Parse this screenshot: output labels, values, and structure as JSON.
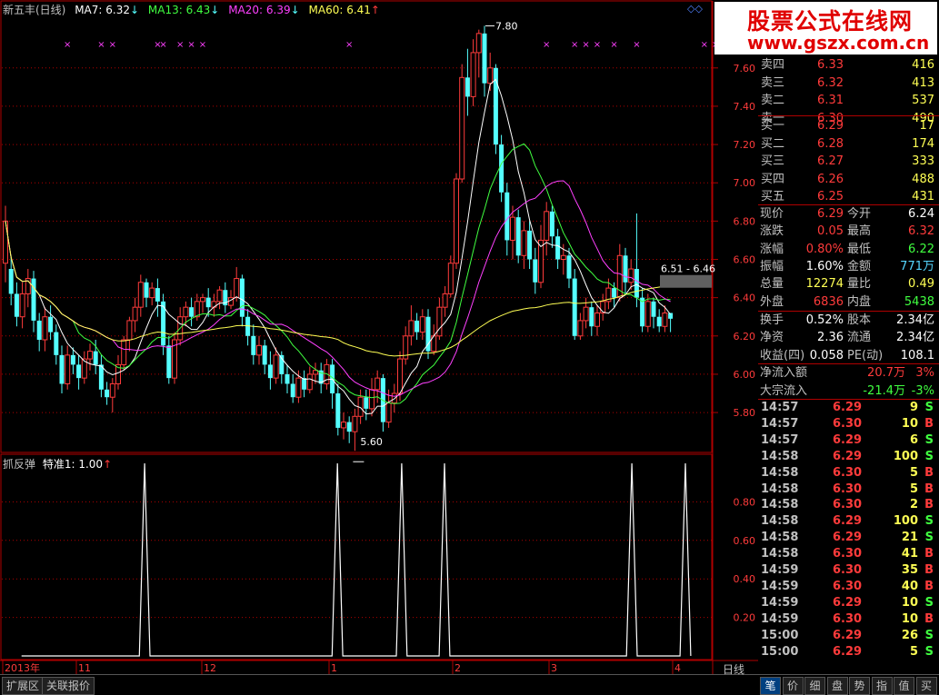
{
  "header": {
    "stock": "新五丰(日线)",
    "ma7": "MA7: 6.32",
    "ma13": "MA13: 6.43",
    "ma20": "MA20: 6.39",
    "ma60": "MA60: 6.41",
    "arrow_down": "↓",
    "arrow_up": "↑",
    "corner_icons": "◇◇"
  },
  "indicator": {
    "title": "抓反弹",
    "value": "特准1: 1.00",
    "arrow": "↑"
  },
  "chart_data": {
    "type": "candlestick",
    "title": "新五丰(日线)",
    "price_ticks": [
      "7.60",
      "7.40",
      "7.20",
      "7.00",
      "6.80",
      "6.60",
      "6.40",
      "6.20",
      "6.00",
      "5.80"
    ],
    "price_range": [
      5.62,
      7.86
    ],
    "indicator_ticks": [
      "0.80",
      "0.60",
      "0.40",
      "0.20"
    ],
    "indicator_range": [
      0,
      1
    ],
    "x_labels": [
      "2013年",
      "11",
      "12",
      "1",
      "2",
      "3",
      "4"
    ],
    "annotations": {
      "high": "7.80",
      "low": "5.60",
      "range": "6.51 - 6.46"
    },
    "candles": [
      [
        6.58,
        6.8,
        6.48,
        6.88
      ],
      [
        6.55,
        6.42,
        6.36,
        6.62
      ],
      [
        6.42,
        6.3,
        6.25,
        6.48
      ],
      [
        6.3,
        6.42,
        6.24,
        6.48
      ],
      [
        6.42,
        6.5,
        6.35,
        6.55
      ],
      [
        6.5,
        6.28,
        6.22,
        6.54
      ],
      [
        6.28,
        6.18,
        6.12,
        6.32
      ],
      [
        6.18,
        6.3,
        6.12,
        6.35
      ],
      [
        6.3,
        6.22,
        6.18,
        6.36
      ],
      [
        6.22,
        6.1,
        6.05,
        6.26
      ],
      [
        6.1,
        5.95,
        5.9,
        6.15
      ],
      [
        5.95,
        6.1,
        5.92,
        6.15
      ],
      [
        6.1,
        6.05,
        6.0,
        6.14
      ],
      [
        6.05,
        5.98,
        5.92,
        6.1
      ],
      [
        5.98,
        6.08,
        5.95,
        6.12
      ],
      [
        6.08,
        6.12,
        6.02,
        6.16
      ],
      [
        6.12,
        6.05,
        6.0,
        6.18
      ],
      [
        6.05,
        5.92,
        5.88,
        6.1
      ],
      [
        5.92,
        5.88,
        5.84,
        5.96
      ],
      [
        5.88,
        5.95,
        5.8,
        5.98
      ],
      [
        5.95,
        6.05,
        5.92,
        6.1
      ],
      [
        6.05,
        6.18,
        6.02,
        6.2
      ],
      [
        6.18,
        6.28,
        6.12,
        6.3
      ],
      [
        6.28,
        6.35,
        6.22,
        6.4
      ],
      [
        6.35,
        6.48,
        6.3,
        6.52
      ],
      [
        6.48,
        6.4,
        6.35,
        6.5
      ],
      [
        6.4,
        6.45,
        6.36,
        6.48
      ],
      [
        6.45,
        6.38,
        6.3,
        6.5
      ],
      [
        6.38,
        6.15,
        6.1,
        6.42
      ],
      [
        6.15,
        5.98,
        5.95,
        6.2
      ],
      [
        5.98,
        6.18,
        5.95,
        6.22
      ],
      [
        6.18,
        6.3,
        6.15,
        6.35
      ],
      [
        6.3,
        6.35,
        6.25,
        6.38
      ],
      [
        6.35,
        6.3,
        6.25,
        6.4
      ],
      [
        6.3,
        6.38,
        6.28,
        6.42
      ],
      [
        6.38,
        6.4,
        6.32,
        6.42
      ],
      [
        6.4,
        6.35,
        6.3,
        6.45
      ],
      [
        6.35,
        6.38,
        6.3,
        6.42
      ],
      [
        6.38,
        6.44,
        6.34,
        6.46
      ],
      [
        6.44,
        6.36,
        6.32,
        6.48
      ],
      [
        6.36,
        6.4,
        6.34,
        6.44
      ],
      [
        6.4,
        6.5,
        6.38,
        6.56
      ],
      [
        6.5,
        6.3,
        6.25,
        6.52
      ],
      [
        6.3,
        6.2,
        6.15,
        6.34
      ],
      [
        6.2,
        6.1,
        6.05,
        6.26
      ],
      [
        6.1,
        6.15,
        6.05,
        6.2
      ],
      [
        6.15,
        6.05,
        6.0,
        6.18
      ],
      [
        6.05,
        5.98,
        5.92,
        6.12
      ],
      [
        5.98,
        6.1,
        5.95,
        6.14
      ],
      [
        6.1,
        6.0,
        5.95,
        6.12
      ],
      [
        6.0,
        5.95,
        5.9,
        6.05
      ],
      [
        5.95,
        5.88,
        5.85,
        6.0
      ],
      [
        5.88,
        5.98,
        5.85,
        6.02
      ],
      [
        5.98,
        5.92,
        5.88,
        6.02
      ],
      [
        5.92,
        6.0,
        5.9,
        6.04
      ],
      [
        6.0,
        6.02,
        5.95,
        6.06
      ],
      [
        6.02,
        5.95,
        5.9,
        6.06
      ],
      [
        5.95,
        6.05,
        5.92,
        6.08
      ],
      [
        6.05,
        5.9,
        5.82,
        6.08
      ],
      [
        5.9,
        5.72,
        5.68,
        5.95
      ],
      [
        5.72,
        5.75,
        5.66,
        5.8
      ],
      [
        5.75,
        5.7,
        5.64,
        5.78
      ],
      [
        5.7,
        5.78,
        5.6,
        5.82
      ],
      [
        5.78,
        5.88,
        5.74,
        5.92
      ],
      [
        5.88,
        5.82,
        5.76,
        5.92
      ],
      [
        5.82,
        5.92,
        5.78,
        5.98
      ],
      [
        5.92,
        5.98,
        5.85,
        6.02
      ],
      [
        5.98,
        5.75,
        5.7,
        6.0
      ],
      [
        5.75,
        5.85,
        5.72,
        5.92
      ],
      [
        5.85,
        5.9,
        5.8,
        5.95
      ],
      [
        5.9,
        6.08,
        5.86,
        6.12
      ],
      [
        6.08,
        6.2,
        6.05,
        6.25
      ],
      [
        6.2,
        6.28,
        6.15,
        6.36
      ],
      [
        6.28,
        6.22,
        6.18,
        6.32
      ],
      [
        6.22,
        6.3,
        6.18,
        6.34
      ],
      [
        6.3,
        6.12,
        6.08,
        6.34
      ],
      [
        6.12,
        6.2,
        6.1,
        6.26
      ],
      [
        6.2,
        6.35,
        6.18,
        6.4
      ],
      [
        6.35,
        6.42,
        6.3,
        6.46
      ],
      [
        6.42,
        6.58,
        6.4,
        6.62
      ],
      [
        6.58,
        7.02,
        6.55,
        7.05
      ],
      [
        7.02,
        7.55,
        7.0,
        7.62
      ],
      [
        7.55,
        7.45,
        7.35,
        7.7
      ],
      [
        7.45,
        7.68,
        7.4,
        7.75
      ],
      [
        7.68,
        7.78,
        7.55,
        7.8
      ],
      [
        7.78,
        7.52,
        7.45,
        7.82
      ],
      [
        7.52,
        7.6,
        7.48,
        7.68
      ],
      [
        7.6,
        7.2,
        7.15,
        7.62
      ],
      [
        7.2,
        6.95,
        6.9,
        7.25
      ],
      [
        6.95,
        6.7,
        6.62,
        7.0
      ],
      [
        6.7,
        6.82,
        6.6,
        6.88
      ],
      [
        6.82,
        6.62,
        6.58,
        6.86
      ],
      [
        6.62,
        6.75,
        6.55,
        6.8
      ],
      [
        6.75,
        6.6,
        6.55,
        6.8
      ],
      [
        6.6,
        6.48,
        6.42,
        6.66
      ],
      [
        6.48,
        6.7,
        6.45,
        6.78
      ],
      [
        6.7,
        6.85,
        6.62,
        6.9
      ],
      [
        6.85,
        6.72,
        6.66,
        6.88
      ],
      [
        6.72,
        6.6,
        6.55,
        6.76
      ],
      [
        6.6,
        6.62,
        6.52,
        6.68
      ],
      [
        6.62,
        6.5,
        6.45,
        6.66
      ],
      [
        6.5,
        6.2,
        6.18,
        6.55
      ],
      [
        6.2,
        6.28,
        6.18,
        6.32
      ],
      [
        6.28,
        6.35,
        6.24,
        6.4
      ],
      [
        6.35,
        6.25,
        6.2,
        6.38
      ],
      [
        6.25,
        6.32,
        6.2,
        6.36
      ],
      [
        6.32,
        6.38,
        6.28,
        6.42
      ],
      [
        6.38,
        6.45,
        6.34,
        6.5
      ],
      [
        6.45,
        6.4,
        6.35,
        6.48
      ],
      [
        6.4,
        6.62,
        6.38,
        6.68
      ],
      [
        6.62,
        6.48,
        6.42,
        6.66
      ],
      [
        6.48,
        6.55,
        6.44,
        6.6
      ],
      [
        6.55,
        6.4,
        6.35,
        6.84
      ],
      [
        6.4,
        6.25,
        6.22,
        6.45
      ],
      [
        6.25,
        6.38,
        6.22,
        6.42
      ],
      [
        6.38,
        6.3,
        6.24,
        6.4
      ],
      [
        6.3,
        6.25,
        6.22,
        6.34
      ],
      [
        6.25,
        6.32,
        6.22,
        6.36
      ],
      [
        6.32,
        6.29,
        6.22,
        6.32
      ]
    ],
    "signals": [
      26,
      62,
      74,
      82,
      117,
      127,
      132
    ],
    "mark_columns": [
      11,
      17,
      19,
      27,
      28,
      31,
      33,
      35,
      61,
      96,
      101,
      103,
      105,
      108,
      112,
      124,
      126,
      128
    ]
  },
  "quotes": {
    "ask": [
      {
        "label": "卖四",
        "price": "6.33",
        "vol": "416"
      },
      {
        "label": "卖三",
        "price": "6.32",
        "vol": "413"
      },
      {
        "label": "卖二",
        "price": "6.31",
        "vol": "537"
      },
      {
        "label": "卖一",
        "price": "6.30",
        "vol": "490"
      }
    ],
    "bid": [
      {
        "label": "买一",
        "price": "6.29",
        "vol": "17"
      },
      {
        "label": "买二",
        "price": "6.28",
        "vol": "174"
      },
      {
        "label": "买三",
        "price": "6.27",
        "vol": "333"
      },
      {
        "label": "买四",
        "price": "6.26",
        "vol": "488"
      },
      {
        "label": "买五",
        "price": "6.25",
        "vol": "431"
      }
    ],
    "stats": [
      {
        "l1": "现价",
        "v1": "6.29",
        "c1": "#ff3b3b",
        "l2": "今开",
        "v2": "6.24",
        "c2": "#ffffff"
      },
      {
        "l1": "涨跌",
        "v1": "0.05",
        "c1": "#ff3b3b",
        "l2": "最高",
        "v2": "6.32",
        "c2": "#ff3b3b"
      },
      {
        "l1": "涨幅",
        "v1": "0.80%",
        "c1": "#ff3b3b",
        "l2": "最低",
        "v2": "6.22",
        "c2": "#40ff40"
      },
      {
        "l1": "振幅",
        "v1": "1.60%",
        "c1": "#ffffff",
        "l2": "金额",
        "v2": "771万",
        "c2": "#56d6ff"
      },
      {
        "l1": "总量",
        "v1": "12274",
        "c1": "#ffff54",
        "l2": "量比",
        "v2": "0.49",
        "c2": "#ffff54"
      },
      {
        "l1": "外盘",
        "v1": "6836",
        "c1": "#ff3b3b",
        "l2": "内盘",
        "v2": "5438",
        "c2": "#40ff40"
      }
    ],
    "stats2": [
      {
        "l1": "换手",
        "v1": "0.52%",
        "l2": "股本",
        "v2": "2.34亿"
      },
      {
        "l1": "净资",
        "v1": "2.36",
        "l2": "流通",
        "v2": "2.34亿"
      },
      {
        "l1": "收益(四)",
        "v1": "0.058",
        "l2": "PE(动)",
        "v2": "108.1"
      }
    ],
    "flow": [
      {
        "label": "净流入额",
        "value": "20.7万",
        "pct": "3%",
        "color": "#ff3b3b"
      },
      {
        "label": "大宗流入",
        "value": "-21.4万",
        "pct": "-3%",
        "color": "#40ff40"
      }
    ]
  },
  "ticks": [
    {
      "t": "14:57",
      "p": "6.29",
      "v": "9",
      "bs": "S"
    },
    {
      "t": "14:57",
      "p": "6.30",
      "v": "10",
      "bs": "B"
    },
    {
      "t": "14:57",
      "p": "6.29",
      "v": "6",
      "bs": "S"
    },
    {
      "t": "14:58",
      "p": "6.29",
      "v": "100",
      "bs": "S"
    },
    {
      "t": "14:58",
      "p": "6.30",
      "v": "5",
      "bs": "B"
    },
    {
      "t": "14:58",
      "p": "6.30",
      "v": "5",
      "bs": "B"
    },
    {
      "t": "14:58",
      "p": "6.30",
      "v": "2",
      "bs": "B"
    },
    {
      "t": "14:58",
      "p": "6.29",
      "v": "100",
      "bs": "S"
    },
    {
      "t": "14:58",
      "p": "6.29",
      "v": "21",
      "bs": "S"
    },
    {
      "t": "14:58",
      "p": "6.30",
      "v": "41",
      "bs": "B"
    },
    {
      "t": "14:59",
      "p": "6.30",
      "v": "35",
      "bs": "B"
    },
    {
      "t": "14:59",
      "p": "6.30",
      "v": "40",
      "bs": "B"
    },
    {
      "t": "14:59",
      "p": "6.29",
      "v": "10",
      "bs": "S"
    },
    {
      "t": "14:59",
      "p": "6.30",
      "v": "10",
      "bs": "B"
    },
    {
      "t": "15:00",
      "p": "6.29",
      "v": "26",
      "bs": "S"
    },
    {
      "t": "15:00",
      "p": "6.29",
      "v": "5",
      "bs": "S"
    }
  ],
  "bottom_tabs": {
    "ext": "扩展区",
    "related": "关联报价",
    "period": "日线"
  },
  "right_tabs": [
    "笔",
    "价",
    "细",
    "盘",
    "势",
    "指",
    "值",
    "买"
  ],
  "logo": {
    "line1": "股票公式在线网",
    "line2": "www.gszx.com.cn"
  },
  "colors": {
    "up": "#ff3b3b",
    "down": "#54ffff",
    "ma7": "#ffffff",
    "ma13": "#40ff40",
    "ma20": "#ff40ff",
    "ma60": "#ffff54",
    "grid": "#b00000",
    "frame": "#b00000"
  }
}
